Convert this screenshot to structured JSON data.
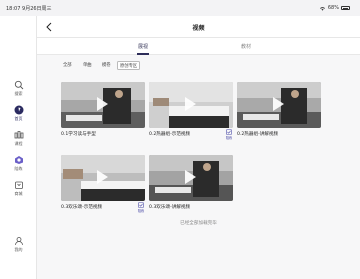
{
  "status": {
    "time": "18:07",
    "date": "9月26日周三",
    "battery": "68%"
  },
  "sidebar": {
    "items": [
      {
        "label": "搜索",
        "icon": "search-icon"
      },
      {
        "label": "首页",
        "icon": "home-icon"
      },
      {
        "label": "课程",
        "icon": "course-icon"
      },
      {
        "label": "陪练",
        "icon": "practice-icon"
      },
      {
        "label": "商城",
        "icon": "shop-icon"
      },
      {
        "label": "我的",
        "icon": "user-icon"
      }
    ],
    "active_index": 1
  },
  "header": {
    "title": "视频",
    "back_icon": "back-arrow-icon"
  },
  "tabs": [
    {
      "label": "展视"
    },
    {
      "label": "教材"
    }
  ],
  "active_tab": 0,
  "filters": [
    {
      "label": "全部"
    },
    {
      "label": "单曲"
    },
    {
      "label": "模卷"
    },
    {
      "label": "原创专区"
    }
  ],
  "active_filter": 3,
  "videos": [
    {
      "title": "0.1学习读与手型",
      "practice": false
    },
    {
      "title": "0.2热器组-示范视频",
      "practice": true,
      "practice_label": "陪练"
    },
    {
      "title": "0.2热器组-讲解视频",
      "practice": false
    },
    {
      "title": "0.3欢乐颂-示范视频",
      "practice": true,
      "practice_label": "陪练"
    },
    {
      "title": "0.3欢乐颂-讲解视频",
      "practice": false
    }
  ],
  "footer_text": "已经全部加载完毕",
  "colors": {
    "accent": "#2e2e5a",
    "practice": "#4d4da8",
    "background": "#f7f7f8"
  }
}
